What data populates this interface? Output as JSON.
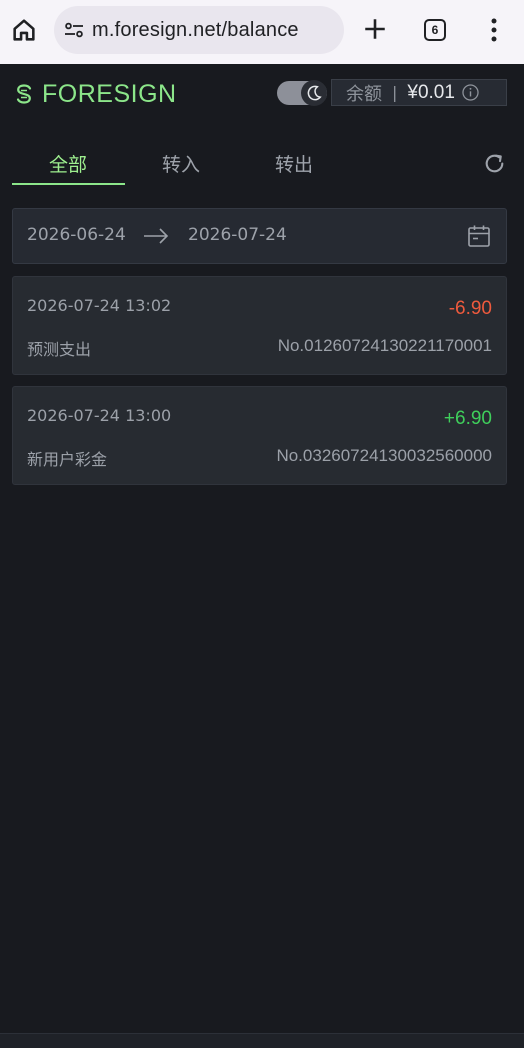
{
  "browser": {
    "url": "m.foresign.net/balance",
    "tab_count": "6"
  },
  "header": {
    "brand": "FORESIGN",
    "balance_label": "余额",
    "balance_separator": "|",
    "balance_value": "¥0.01"
  },
  "tabs": [
    {
      "label": "全部",
      "active": true
    },
    {
      "label": "转入",
      "active": false
    },
    {
      "label": "转出",
      "active": false
    }
  ],
  "date_range": {
    "start": "2026-06-24",
    "end": "2026-07-24"
  },
  "transactions": [
    {
      "time": "2026-07-24 13:02",
      "amount": "-6.90",
      "type": "预测支出",
      "number": "No.01260724130221170001"
    },
    {
      "time": "2026-07-24 13:00",
      "amount": "+6.90",
      "type": "新用户彩金",
      "number": "No.03260724130032560000"
    }
  ],
  "colors": {
    "brand": "#8ce68a",
    "negative": "#ee5a3d",
    "positive": "#3fcf5b",
    "background": "#181a1f"
  },
  "icons": {
    "home": "home-icon",
    "site_settings": "tune-icon",
    "new_tab": "plus-icon",
    "menu": "more-vert-icon",
    "brand": "dollar-s-icon",
    "theme": "moon-icon",
    "info": "info-icon",
    "refresh": "refresh-icon",
    "arrow": "arrow-right-icon",
    "calendar": "calendar-icon"
  }
}
